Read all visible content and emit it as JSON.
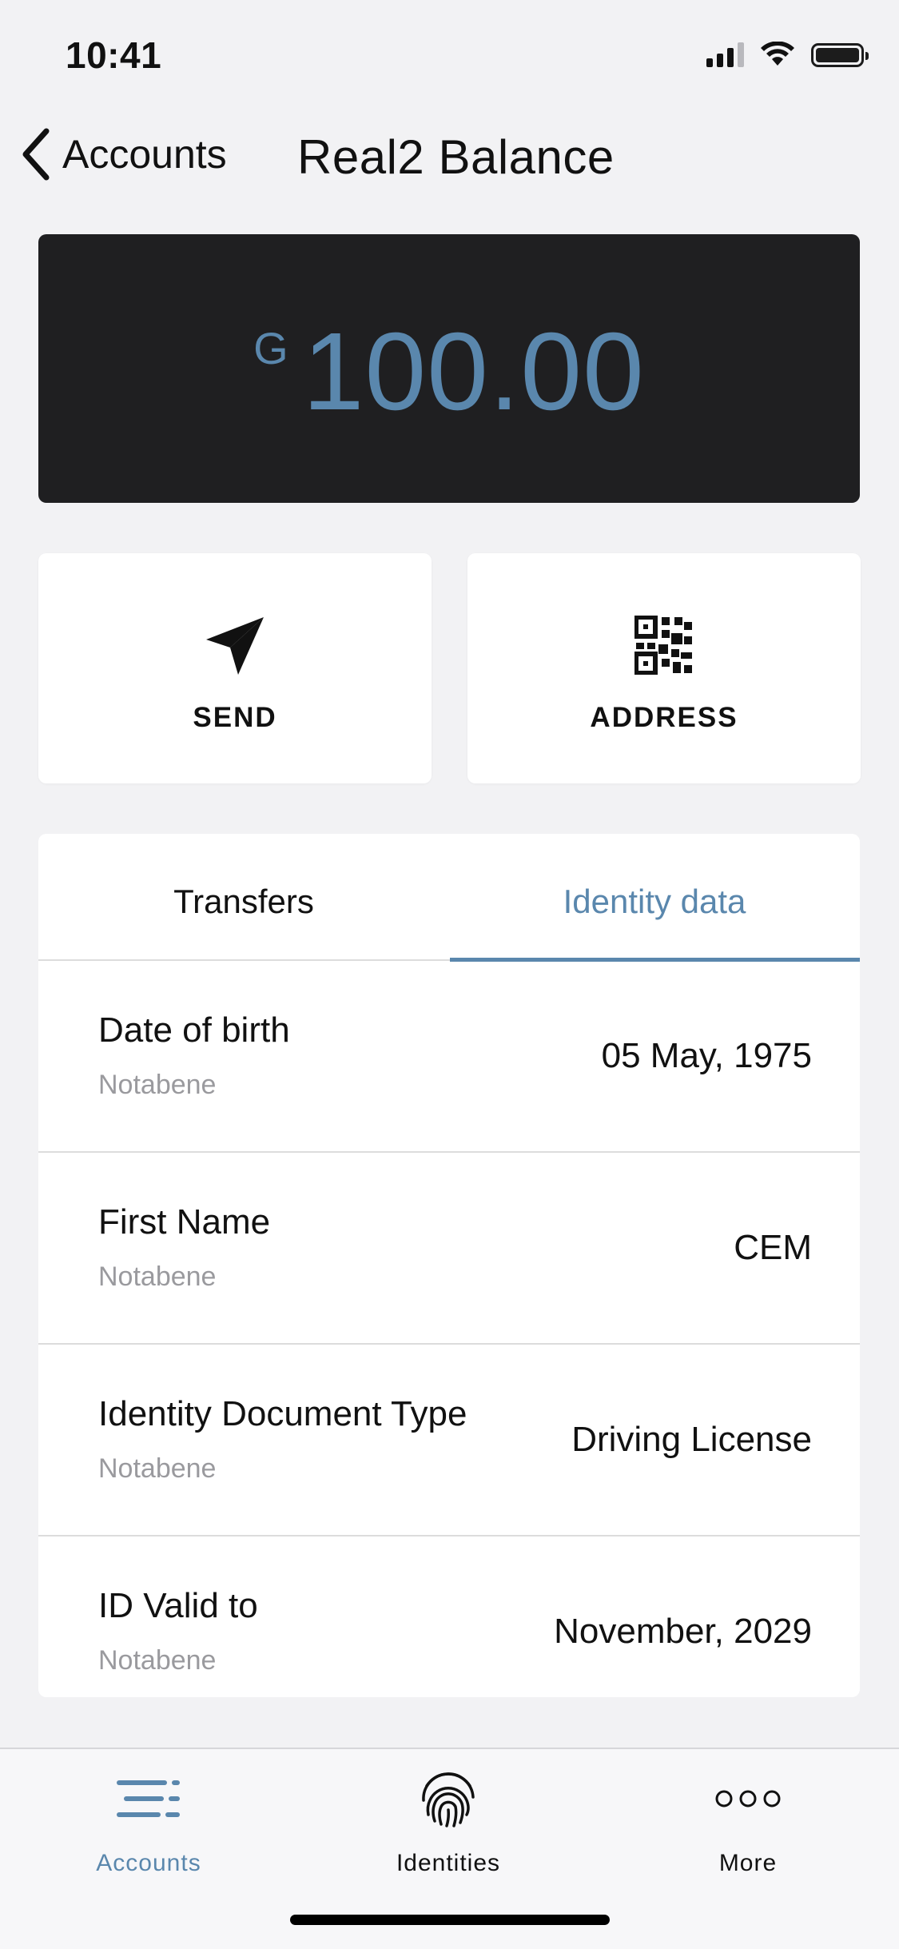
{
  "status_bar": {
    "time": "10:41"
  },
  "nav": {
    "back_label": "Accounts",
    "title": "Real2 Balance"
  },
  "balance": {
    "currency_symbol": "G",
    "amount": "100.00"
  },
  "actions": {
    "send_label": "SEND",
    "address_label": "ADDRESS"
  },
  "tabs": [
    {
      "label": "Transfers",
      "active": false
    },
    {
      "label": "Identity data",
      "active": true
    }
  ],
  "identity_rows": [
    {
      "label": "Date of birth",
      "source": "Notabene",
      "value": "05 May, 1975"
    },
    {
      "label": "First Name",
      "source": "Notabene",
      "value": "CEM"
    },
    {
      "label": "Identity Document Type",
      "source": "Notabene",
      "value": "Driving License"
    },
    {
      "label": "ID Valid to",
      "source": "Notabene",
      "value": "November, 2029"
    }
  ],
  "tab_bar": {
    "items": [
      {
        "label": "Accounts",
        "icon": "accounts-list-icon",
        "active": true
      },
      {
        "label": "Identities",
        "icon": "fingerprint-icon",
        "active": false
      },
      {
        "label": "More",
        "icon": "more-dots-icon",
        "active": false
      }
    ]
  },
  "colors": {
    "accent": "#5a87ad",
    "card_dark": "#1f1f21",
    "background": "#f2f2f4"
  }
}
